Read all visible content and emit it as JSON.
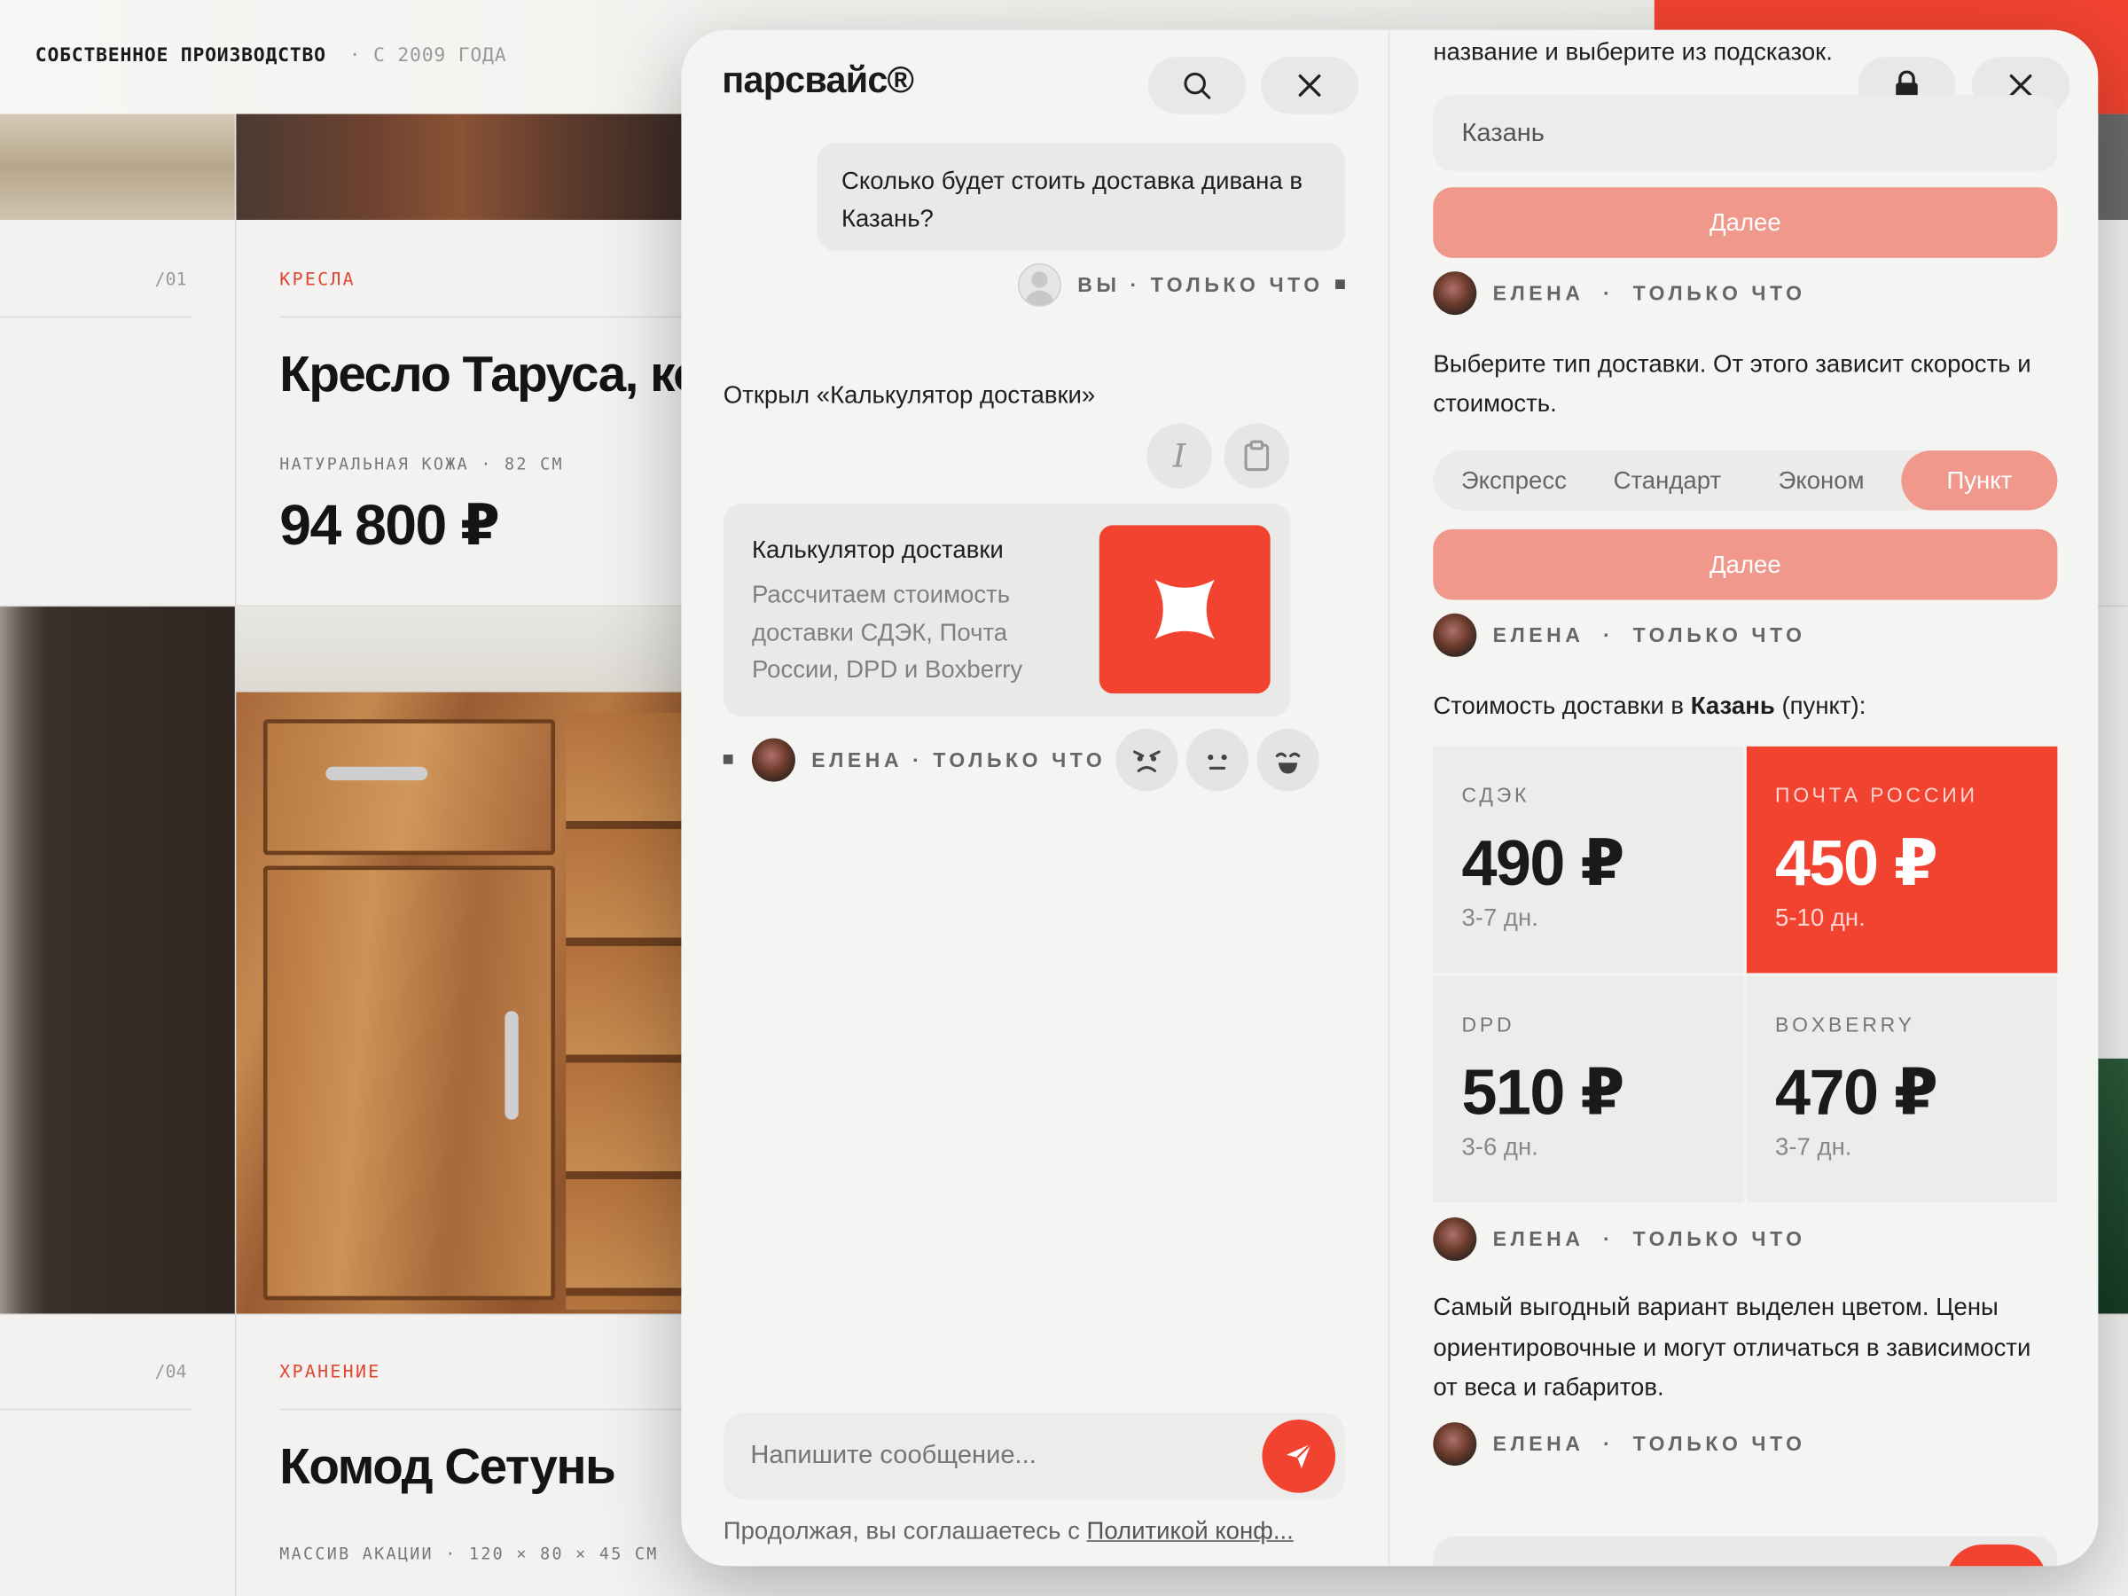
{
  "background": {
    "header_brand": "СОБСТВЕННОЕ ПРОИЗВОДСТВО",
    "header_since": "· С 2009 ГОДА",
    "products": [
      {
        "index": "/01",
        "category": "КРЕСЛА",
        "title": "Кресло Таруса, ко",
        "specs": "НАТУРАЛЬНАЯ КОЖА · 82 СМ",
        "price": "94 800 ₽"
      },
      {
        "index": "/04",
        "category": "ХРАНЕНИЕ",
        "title": "Комод Сетунь",
        "specs": "МАССИВ АКАЦИИ · 120 × 80 × 45 СМ",
        "price": ""
      }
    ]
  },
  "chat": {
    "brand": "парсвайс®",
    "search_icon": "search-icon",
    "close_icon": "close-icon",
    "user_message": "Сколько будет стоить доставка дивана в Казань?",
    "user_meta": "ВЫ · ТОЛЬКО ЧТО",
    "opened_text": "Открыл «Калькулятор доставки»",
    "tool_card": {
      "title": "Калькулятор доставки",
      "description": "Рассчитаем стоимость доставки СДЭК, Почта России, DPD и Boxberry",
      "accent": "#f24331"
    },
    "agent_meta": "ЕЛЕНА · ТОЛЬКО ЧТО",
    "input_placeholder": "Напишите сообщение...",
    "footer_prefix": "Продолжая, вы соглашаетесь с ",
    "footer_link": "Политикой конф..."
  },
  "widget": {
    "top_text": "название и выберите из подсказок.",
    "city_value": "Казань",
    "next_label": "Далее",
    "agent_name": "ЕЛЕНА",
    "agent_time": "ТОЛЬКО ЧТО",
    "delivery_prompt": "Выберите тип доставки. От этого зависит скорость и стоимость.",
    "tabs": [
      "Экспресс",
      "Стандарт",
      "Эконом",
      "Пункт"
    ],
    "selected_tab": "Пункт",
    "result_prefix": "Стоимость доставки в ",
    "result_city": "Казань",
    "result_suffix": " (пункт):",
    "carriers": [
      {
        "name": "СДЭК",
        "price": "490 ₽",
        "days": "3-7 дн.",
        "highlight": false
      },
      {
        "name": "ПОЧТА РОССИИ",
        "price": "450 ₽",
        "days": "5-10 дн.",
        "highlight": true
      },
      {
        "name": "DPD",
        "price": "510 ₽",
        "days": "3-6 дн.",
        "highlight": false
      },
      {
        "name": "BOXBERRY",
        "price": "470 ₽",
        "days": "3-7 дн.",
        "highlight": false
      }
    ],
    "note": "Самый выгодный вариант выделен цветом. Цены ориентировочные и могут отличаться в зависимости от веса и габаритов.",
    "colors": {
      "accent": "#f24331",
      "salmon": "#f0988c"
    }
  }
}
